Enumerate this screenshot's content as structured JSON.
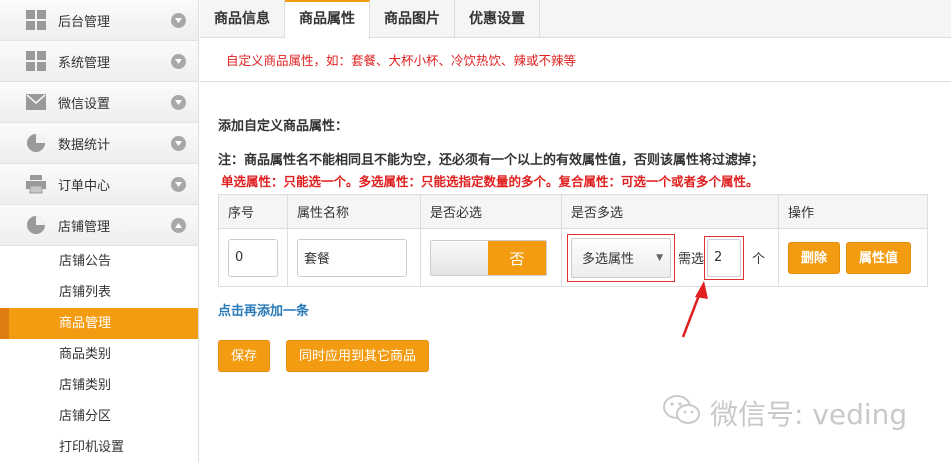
{
  "sidebar": {
    "menu": [
      {
        "label": "后台管理",
        "icon": "grid-icon"
      },
      {
        "label": "系统管理",
        "icon": "grid-icon"
      },
      {
        "label": "微信设置",
        "icon": "mail-icon"
      },
      {
        "label": "数据统计",
        "icon": "pie-chart-icon"
      },
      {
        "label": "订单中心",
        "icon": "printer-icon"
      },
      {
        "label": "店铺管理",
        "icon": "pie-chart-icon"
      }
    ],
    "submenu": [
      "店铺公告",
      "店铺列表",
      "商品管理",
      "商品类别",
      "店铺类别",
      "店铺分区",
      "打印机设置"
    ],
    "active_sub": "商品管理"
  },
  "tabs": [
    "商品信息",
    "商品属性",
    "商品图片",
    "优惠设置"
  ],
  "active_tab": "商品属性",
  "hint": "自定义商品属性，如：套餐、大杯小杯、冷饮热饮、辣或不辣等",
  "section_title": "添加自定义商品属性：",
  "note": "注：商品属性名不能相同且不能为空，还必须有一个以上的有效属性值，否则该属性将过滤掉；",
  "note_red": "单选属性：只能选一个。多选属性：只能选指定数量的多个。复合属性：可选一个或者多个属性。",
  "table": {
    "headers": [
      "序号",
      "属性名称",
      "是否必选",
      "是否多选",
      "操作"
    ],
    "row": {
      "index": "0",
      "name": "套餐",
      "required_label": "否",
      "multi_select": "多选属性",
      "need_label": "需选",
      "count": "2",
      "unit": "个",
      "delete_label": "删除",
      "values_label": "属性值"
    }
  },
  "add_link": "点击再添加一条",
  "buttons": {
    "save": "保存",
    "apply_all": "同时应用到其它商品"
  },
  "watermark": "微信号: veding",
  "colors": {
    "accent": "#f39c12",
    "alert": "#e02020",
    "link": "#2a7ab8"
  }
}
